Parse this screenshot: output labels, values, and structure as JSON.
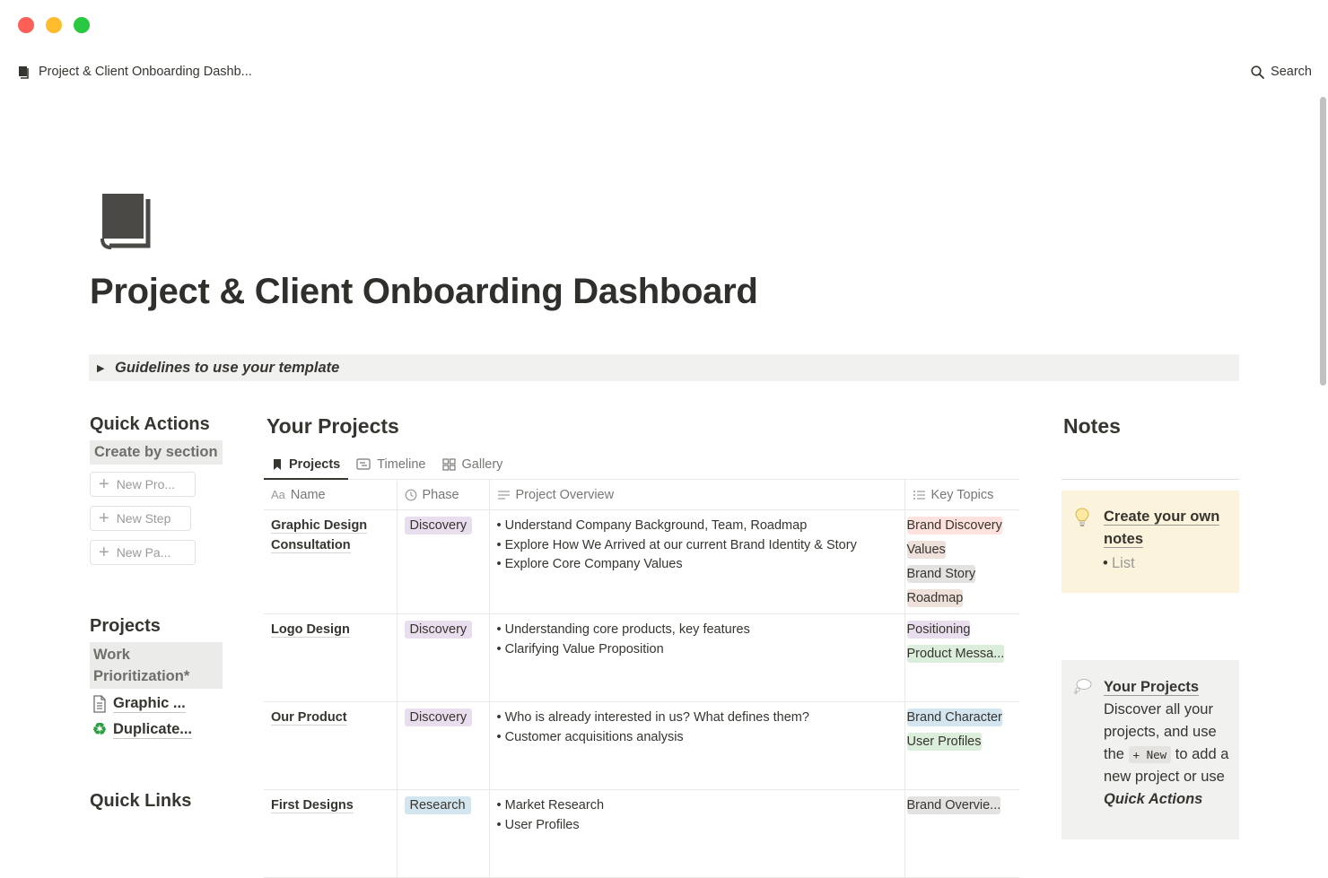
{
  "window": {
    "breadcrumb_title": "Project & Client Onboarding Dashb...",
    "search_label": "Search"
  },
  "page": {
    "title": "Project & Client Onboarding Dashboard",
    "toggle_label": "Guidelines to use your template"
  },
  "left": {
    "quick_actions_title": "Quick Actions",
    "create_by_section": "Create by section",
    "new_buttons": [
      "New Pro...",
      "New Step",
      "New Pa..."
    ],
    "projects_title": "Projects",
    "work_prioritization": "Work Prioritization*",
    "project_links": [
      "Graphic ...",
      "Duplicate..."
    ],
    "quick_links_title": "Quick Links"
  },
  "database": {
    "title": "Your Projects",
    "tabs": [
      "Projects",
      "Timeline",
      "Gallery"
    ],
    "columns": [
      "Name",
      "Phase",
      "Project Overview",
      "Key Topics"
    ],
    "name_col_prefix": "Aa",
    "rows": [
      {
        "name": "Graphic Design Consultation",
        "phase": "Discovery",
        "overview": [
          "Understand Company Background, Team, Roadmap",
          "Explore How We Arrived at our current Brand Identity & Story",
          "Explore Core Company Values"
        ],
        "topics": [
          "Brand Discovery",
          "Values",
          "Brand Story",
          "Roadmap"
        ]
      },
      {
        "name": "Logo Design",
        "phase": "Discovery",
        "overview": [
          "Understanding core products, key features",
          "Clarifying Value Proposition"
        ],
        "topics": [
          "Positioning",
          "Product Messa..."
        ]
      },
      {
        "name": "Our Product",
        "phase": "Discovery",
        "overview": [
          "Who is already interested in us? What defines them?",
          "Customer acquisitions analysis"
        ],
        "topics": [
          "Brand Character",
          "User Profiles"
        ]
      },
      {
        "name": "First Designs",
        "phase": "Research",
        "overview": [
          "Market Research",
          "User Profiles"
        ],
        "topics": [
          "Brand Overvie..."
        ]
      }
    ]
  },
  "notes": {
    "title": "Notes",
    "callout1_heading": "Create your own notes",
    "callout1_list_item": "List",
    "callout2_heading": "Your Projects",
    "callout2_text_a": "Discover all your projects, and use the",
    "callout2_code": "+ New",
    "callout2_text_b": "to add a new project or use",
    "callout2_tail": "Quick Actions"
  },
  "colors": {
    "discovery_bg": "#e8deee",
    "research_bg": "#d3e5ef",
    "red_bg": "#ffe2dd",
    "brown_bg": "#eee0da",
    "gray_bg": "#e3e2e0",
    "purple_bg": "#e8deee",
    "green_bg": "#dbeddb",
    "blue_bg": "#d3e5ef",
    "callout_yellow": "#fbf3db",
    "callout_gray": "#f1f1ef"
  }
}
